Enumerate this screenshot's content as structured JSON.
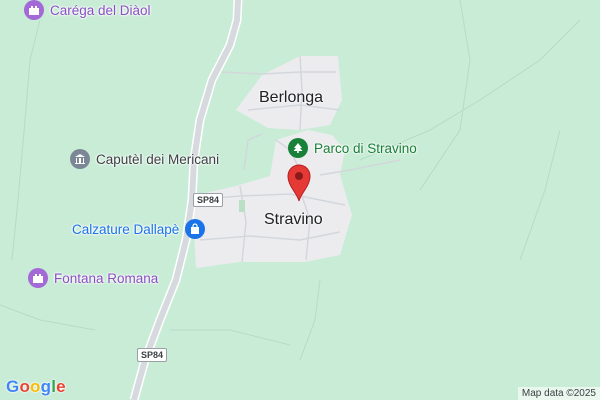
{
  "places": {
    "berlonga": "Berlonga",
    "stravino": "Stravino"
  },
  "pois": {
    "carega": "Caréga del Diàol",
    "caputel": "Caputèl dei Mericani",
    "parco": "Parco di Stravino",
    "calzature": "Calzature Dallapè",
    "fontana": "Fontana Romana"
  },
  "roads": {
    "shield_upper": "SP84",
    "shield_lower": "SP84"
  },
  "icons": {
    "landmark": "castle-icon",
    "monument": "monument-icon",
    "park": "tree-icon",
    "shopping": "shopping-bag-icon",
    "pin": "map-pin-icon"
  },
  "colors": {
    "background": "#c8ecd6",
    "settlement": "#ededf0",
    "road": "#cfd3d8",
    "landmark_purple": "#a369d6",
    "park_green": "#188038",
    "shop_blue": "#1a73e8",
    "pin_red": "#e53935"
  },
  "footer": {
    "logo": [
      "G",
      "o",
      "o",
      "g",
      "l",
      "e"
    ],
    "attribution": "Map data ©2025"
  }
}
